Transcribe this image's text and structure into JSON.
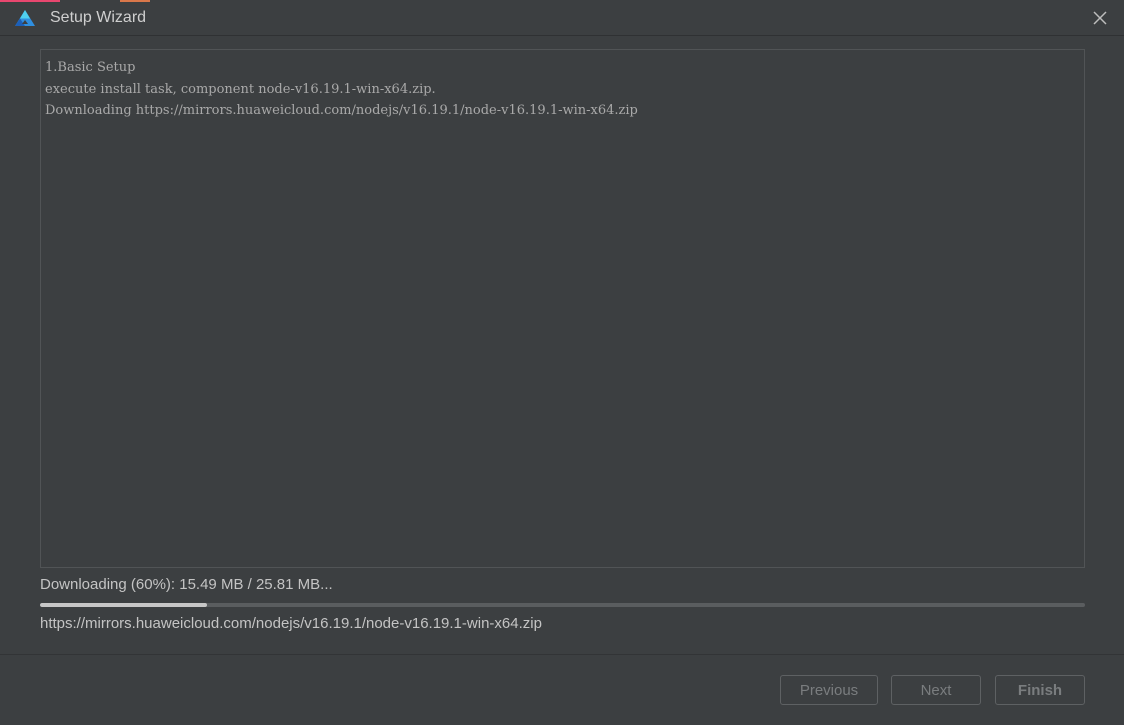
{
  "window": {
    "title": "Setup Wizard"
  },
  "console": {
    "lines": [
      "1.Basic Setup",
      "execute install task, component node-v16.19.1-win-x64.zip.",
      "Downloading https://mirrors.huaweicloud.com/nodejs/v16.19.1/node-v16.19.1-win-x64.zip"
    ]
  },
  "download": {
    "status": "Downloading (60%): 15.49 MB / 25.81 MB...",
    "progress_fraction": 0.16,
    "url": "https://mirrors.huaweicloud.com/nodejs/v16.19.1/node-v16.19.1-win-x64.zip"
  },
  "buttons": {
    "previous_label": "Previous",
    "next_label": "Next",
    "finish_label": "Finish"
  },
  "icons": {
    "app_logo": "app-logo-icon",
    "close": "close-icon"
  },
  "colors": {
    "background": "#3c3f41",
    "progress_fill": "#c7c7c7",
    "progress_track": "#5a5d5f"
  }
}
